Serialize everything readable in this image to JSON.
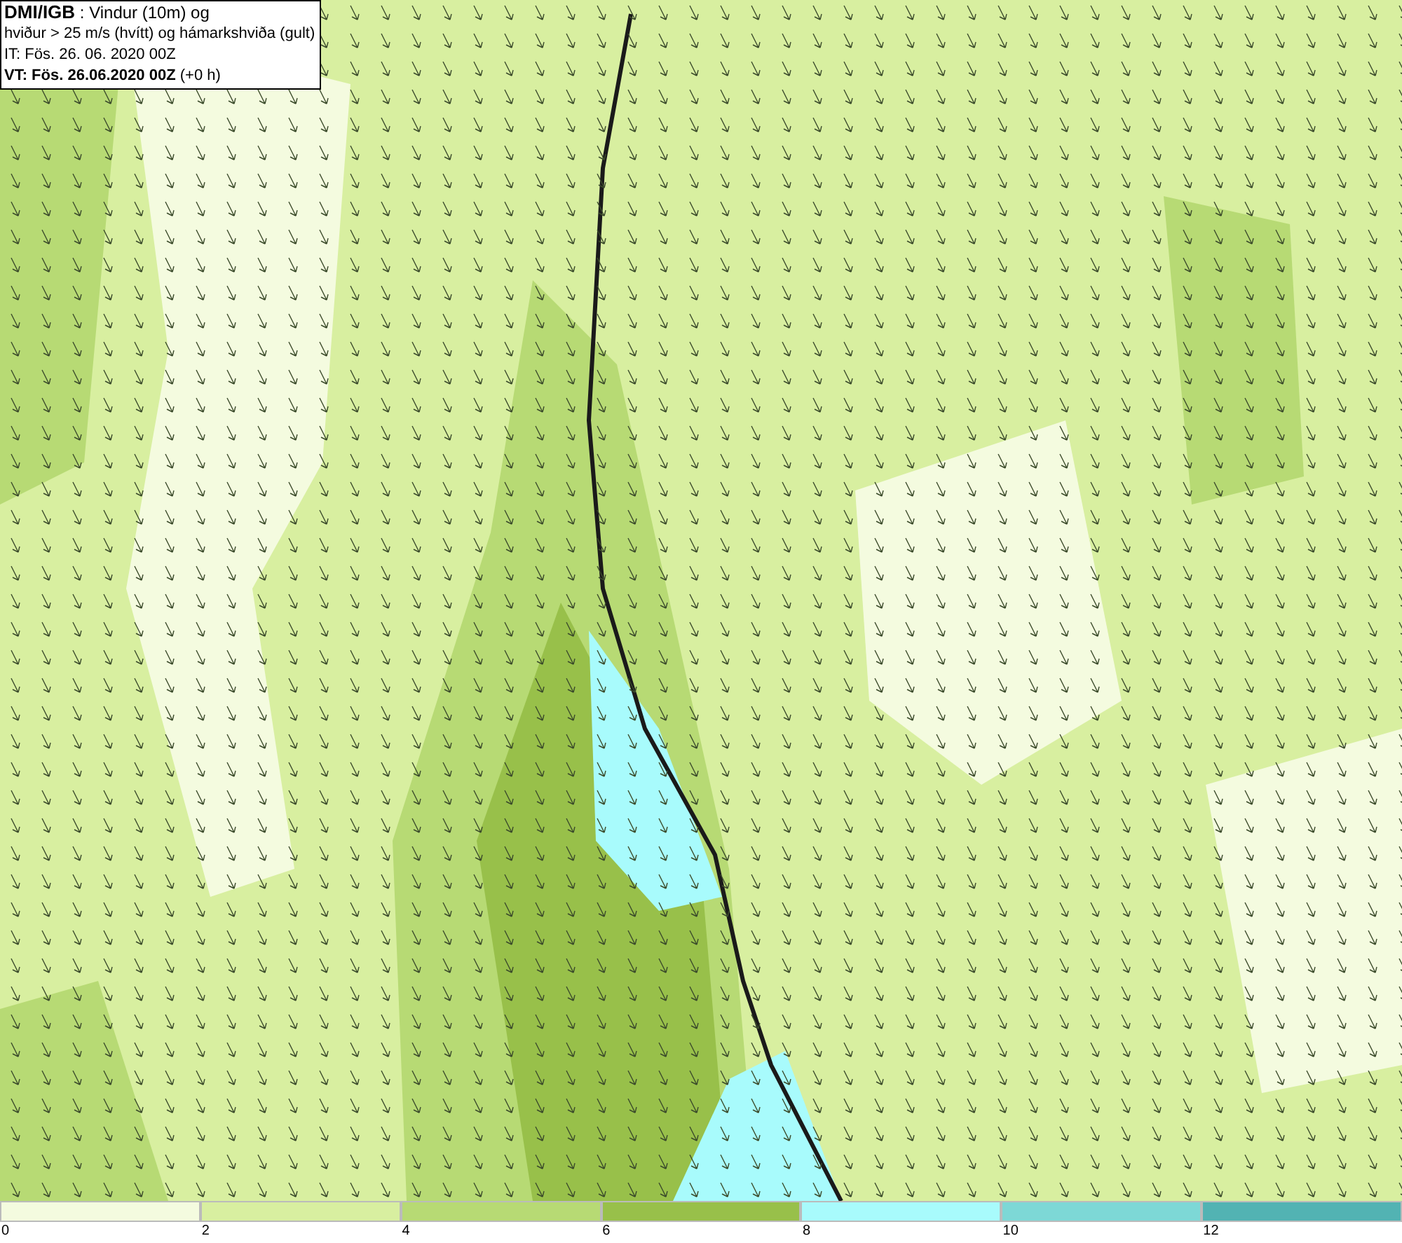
{
  "header": {
    "source": "DMI/IGB",
    "title_rest": " : Vindur (10m) og",
    "line_2": "hviður > 25 m/s (hvítt) og hámarkshviða (gult)",
    "issue_time": "IT: Fös. 26. 06. 2020 00Z",
    "valid_time": "**VT: Fös. 26.06.2020 00Z** (+0 h)"
  },
  "legend": [
    {
      "label": "0",
      "color": "#f4fbdf"
    },
    {
      "label": "2",
      "color": "#d8efa0"
    },
    {
      "label": "4",
      "color": "#b7da74"
    },
    {
      "label": "6",
      "color": "#98c04a"
    },
    {
      "label": "8",
      "color": "#a8fbfc"
    },
    {
      "label": "10",
      "color": "#7dd8d6"
    },
    {
      "label": "12",
      "color": "#52b3b3"
    }
  ]
}
